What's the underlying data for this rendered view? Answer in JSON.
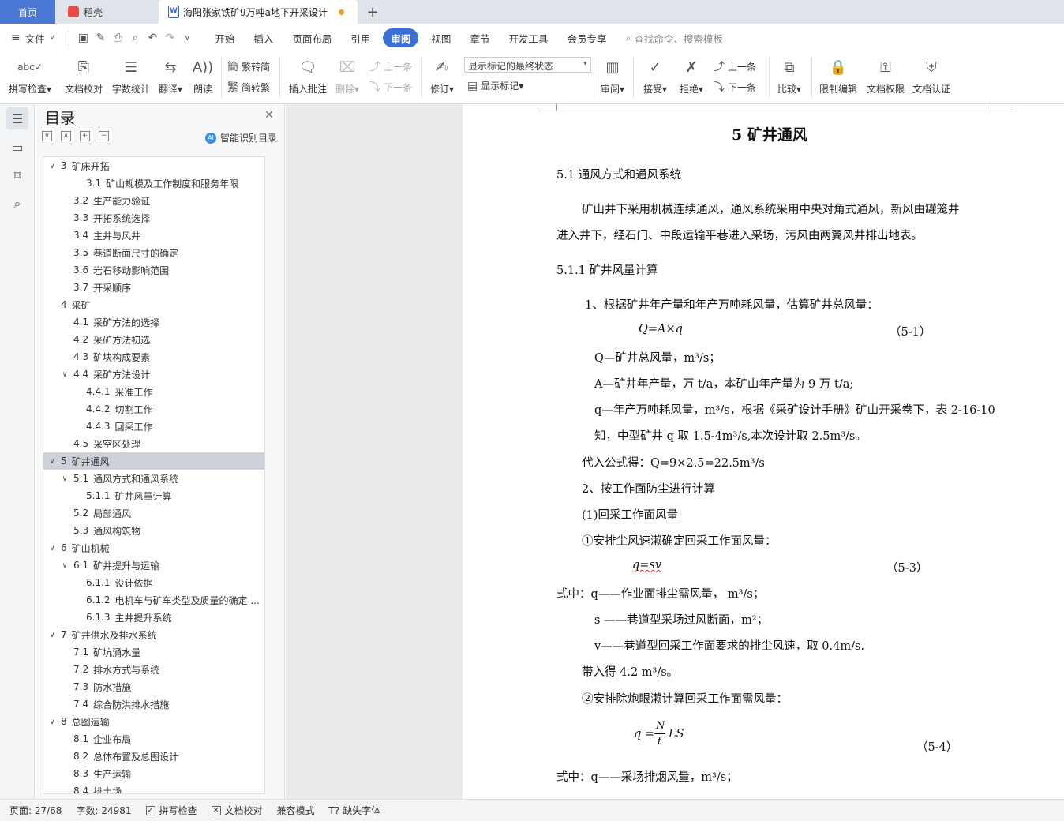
{
  "tabs": {
    "home": "首页",
    "daoke": "稻壳",
    "doc": "海阳张家铁矿9万吨a地下开采设计",
    "add": "+"
  },
  "menu": {
    "file": "文件",
    "items": [
      "开始",
      "插入",
      "页面布局",
      "引用",
      "审阅",
      "视图",
      "章节",
      "开发工具",
      "会员专享"
    ],
    "active": "审阅",
    "search": "查找命令、搜索模板"
  },
  "ribbon": {
    "spell": "拼写检查",
    "proof": "文档校对",
    "wordcount": "字数统计",
    "translate": "翻译",
    "read": "朗读",
    "trad": "繁转简",
    "simp": "简转繁",
    "insert_comment": "插入批注",
    "delete": "删除",
    "prev_c": "上一条",
    "next_c": "下一条",
    "revise": "修订",
    "markup_state": "显示标记的最终状态",
    "show_markup": "显示标记",
    "review": "审阅",
    "accept": "接受",
    "reject": "拒绝",
    "prev_r": "上一条",
    "next_r": "下一条",
    "compare": "比较",
    "restrict": "限制编辑",
    "perm": "文档权限",
    "auth": "文档认证"
  },
  "toc": {
    "title": "目录",
    "smart": "智能识别目录",
    "items": [
      {
        "num": "3",
        "text": "矿床开拓",
        "level": 1,
        "caret": "∨"
      },
      {
        "num": "3.1",
        "text": "矿山规模及工作制度和服务年限",
        "level": 3,
        "caret": ""
      },
      {
        "num": "3.2",
        "text": "生产能力验证",
        "level": 2,
        "caret": ""
      },
      {
        "num": "3.3",
        "text": "开拓系统选择",
        "level": 2,
        "caret": ""
      },
      {
        "num": "3.4",
        "text": "主井与风井",
        "level": 2,
        "caret": ""
      },
      {
        "num": "3.5",
        "text": "巷道断面尺寸的确定",
        "level": 2,
        "caret": ""
      },
      {
        "num": "3.6",
        "text": "岩石移动影响范围",
        "level": 2,
        "caret": ""
      },
      {
        "num": "3.7",
        "text": "开采顺序",
        "level": 2,
        "caret": ""
      },
      {
        "num": "4",
        "text": "采矿",
        "level": 1,
        "caret": " "
      },
      {
        "num": "4.1",
        "text": "采矿方法的选择",
        "level": 2,
        "caret": ""
      },
      {
        "num": "4.2",
        "text": "采矿方法初选",
        "level": 2,
        "caret": ""
      },
      {
        "num": "4.3",
        "text": "矿块构成要素",
        "level": 2,
        "caret": ""
      },
      {
        "num": "4.4",
        "text": "采矿方法设计",
        "level": 2,
        "caret": "∨"
      },
      {
        "num": "4.4.1",
        "text": "采准工作",
        "level": 3,
        "caret": ""
      },
      {
        "num": "4.4.2",
        "text": "切割工作",
        "level": 3,
        "caret": ""
      },
      {
        "num": "4.4.3",
        "text": "回采工作",
        "level": 3,
        "caret": ""
      },
      {
        "num": "4.5",
        "text": "采空区处理",
        "level": 2,
        "caret": ""
      },
      {
        "num": "5",
        "text": "矿井通风",
        "level": 1,
        "caret": "∨",
        "selected": true
      },
      {
        "num": "5.1",
        "text": "通风方式和通风系统",
        "level": 2,
        "caret": "∨"
      },
      {
        "num": "5.1.1",
        "text": "矿井风量计算",
        "level": 3,
        "caret": ""
      },
      {
        "num": "5.2",
        "text": "局部通风",
        "level": 2,
        "caret": ""
      },
      {
        "num": "5.3",
        "text": "通风构筑物",
        "level": 2,
        "caret": ""
      },
      {
        "num": "6",
        "text": "矿山机械",
        "level": 1,
        "caret": "∨"
      },
      {
        "num": "6.1",
        "text": "矿井提升与运输",
        "level": 2,
        "caret": "∨"
      },
      {
        "num": "6.1.1",
        "text": "设计依据",
        "level": 3,
        "caret": ""
      },
      {
        "num": "6.1.2",
        "text": "电机车与矿车类型及质量的确定 ...",
        "level": 3,
        "caret": ""
      },
      {
        "num": "6.1.3",
        "text": "主井提升系统",
        "level": 3,
        "caret": ""
      },
      {
        "num": "7",
        "text": "矿井供水及排水系统",
        "level": 1,
        "caret": "∨"
      },
      {
        "num": "7.1",
        "text": "矿坑涌水量",
        "level": 2,
        "caret": ""
      },
      {
        "num": "7.2",
        "text": "排水方式与系统",
        "level": 2,
        "caret": ""
      },
      {
        "num": "7.3",
        "text": "防水措施",
        "level": 2,
        "caret": ""
      },
      {
        "num": "7.4",
        "text": "综合防洪排水措施",
        "level": 2,
        "caret": ""
      },
      {
        "num": "8",
        "text": "总图运输",
        "level": 1,
        "caret": "∨"
      },
      {
        "num": "8.1",
        "text": "企业布局",
        "level": 2,
        "caret": ""
      },
      {
        "num": "8.2",
        "text": "总体布置及总图设计",
        "level": 2,
        "caret": ""
      },
      {
        "num": "8.3",
        "text": "生产运输",
        "level": 2,
        "caret": ""
      },
      {
        "num": "8.4",
        "text": "排土场",
        "level": 2,
        "caret": ""
      }
    ]
  },
  "doc": {
    "h1": "5  矿井通风",
    "h2a": "5.1  通风方式和通风系统",
    "para1a": "矿山井下采用机械连续通风，通风系统采用中央对角式通风，新风由罐笼井",
    "para1b": "进入井下，经石门、中段运输平巷进入采场，污风由两翼风井排出地表。",
    "h3a": "5.1.1  矿井风量计算",
    "l1": "1、根据矿井年产量和年产万吨耗风量，估算矿井总风量：",
    "f1": "Q=A×q",
    "f1n": "（5-1）",
    "l2": "Q—矿井总风量，m³/s；",
    "l3": "A—矿井年产量，万 t/a，本矿山年产量为 9 万 t/a;",
    "l4": "q—年产万吨耗风量，m³/s，根据《采矿设计手册》矿山开采卷下，表 2-16-10",
    "l5": "知，中型矿井 q 取 1.5-4m³/s,本次设计取 2.5m³/s。",
    "l6": "代入公式得：Q=9×2.5=22.5m³/s",
    "l7": "2、按工作面防尘进行计算",
    "l8": "(1)回采工作面风量",
    "l9": "①安排尘风速濑确定回采工作面风量：",
    "f2": "q=sv",
    "f2n": "（5-3）",
    "l10": "式中：q——作业面排尘需风量，   m³/s；",
    "l11": "s ——巷道型采场过风断面，m²；",
    "l12": "v——巷道型回采工作面要求的排尘风速，取 0.4m/s.",
    "l13": "带入得 4.2 m³/s。",
    "l14": "②安排除炮眼濑计算回采工作面需风量：",
    "f3a": "q =",
    "f3n": "N",
    "f3d": "t",
    "f3b": "LS",
    "f3num": "（5-4）",
    "l15": "式中：q——采场排烟风量，m³/s；"
  },
  "status": {
    "page": "页面: 27/68",
    "words": "字数: 24981",
    "spell": "拼写检查",
    "proof": "文档校对",
    "compat": "兼容模式",
    "font": "缺失字体"
  }
}
